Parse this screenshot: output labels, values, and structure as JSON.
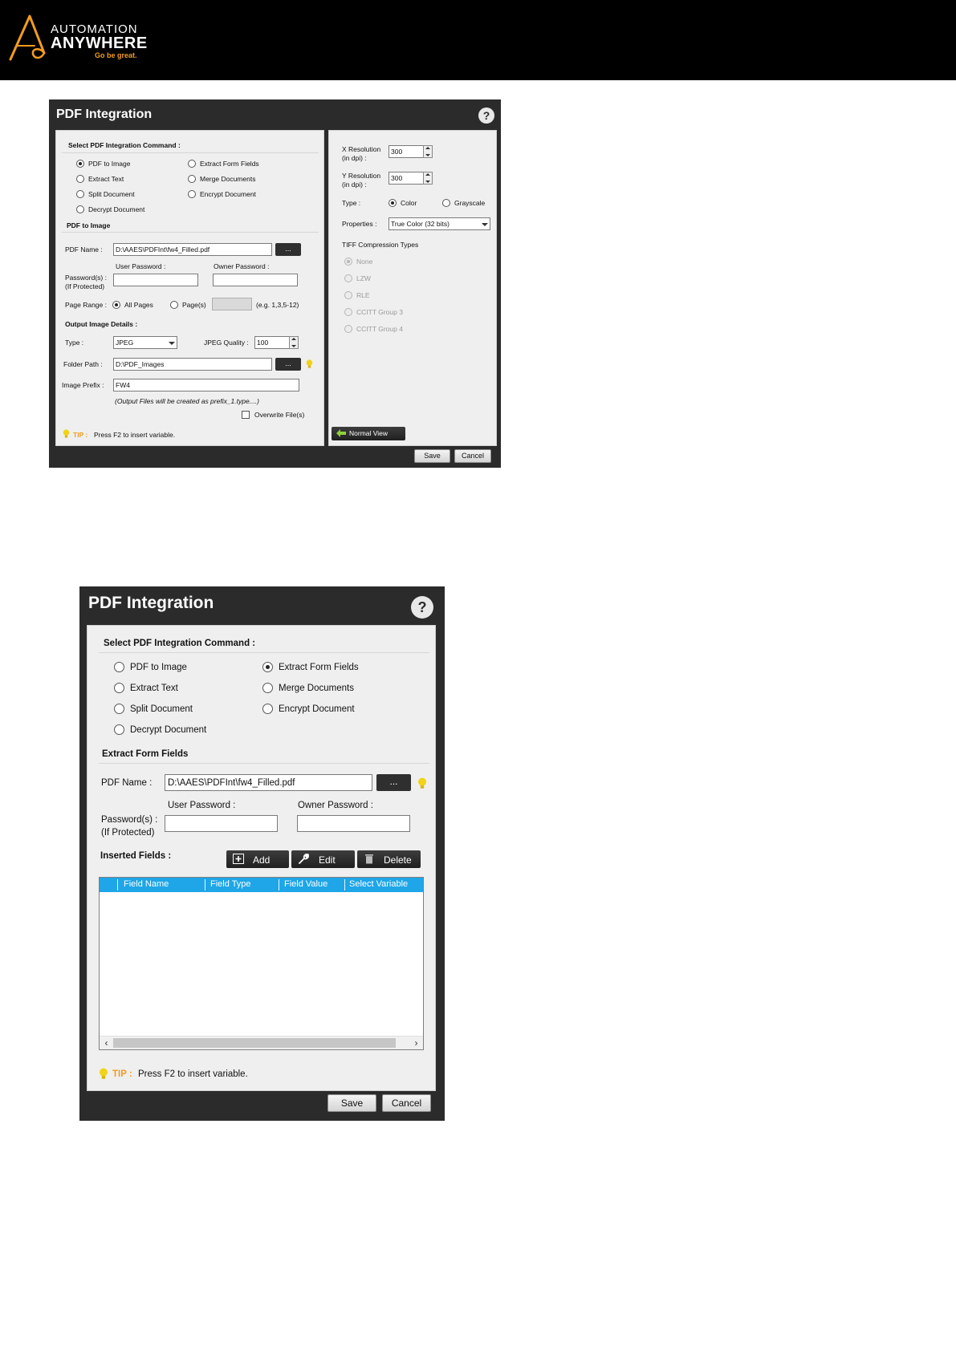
{
  "brand": {
    "line1": "AUTOMATION",
    "line2": "ANYWHERE",
    "tagline": "Go be great.",
    "accent_color": "#f39c1f"
  },
  "dialog1": {
    "title": "PDF Integration",
    "help": "?",
    "section_command": "Select PDF Integration Command :",
    "commands": [
      "PDF to Image",
      "Extract Text",
      "Split Document",
      "Decrypt Document",
      "Extract Form Fields",
      "Merge Documents",
      "Encrypt Document"
    ],
    "selected_command": "PDF to Image",
    "section_mode": "PDF to Image",
    "pdf_name_label": "PDF Name :",
    "pdf_name_value": "D:\\AAES\\PDFInt\\fw4_Filled.pdf",
    "browse_label": "...",
    "user_password_label": "User Password :",
    "owner_password_label": "Owner Password :",
    "passwords_label_1": "Password(s) :",
    "passwords_label_2": "(If Protected)",
    "page_range_label": "Page Range :",
    "all_pages_label": "All Pages",
    "pages_label": "Page(s)",
    "pages_hint": "(e.g. 1,3,5-12)",
    "output_section": "Output Image Details :",
    "type_label": "Type :",
    "type_value": "JPEG",
    "jpeg_quality_label": "JPEG Quality :",
    "jpeg_quality_value": "100",
    "folder_path_label": "Folder Path :",
    "folder_path_value": "D:\\PDF_Images",
    "image_prefix_label": "Image Prefix :",
    "image_prefix_value": "FW4",
    "output_hint": "(Output Files will be created as prefix_1.type....)",
    "overwrite_label": "Overwrite File(s)",
    "tip_label": "TIP :",
    "tip_text": "Press F2 to insert variable.",
    "x_res_label_1": "X Resolution",
    "x_res_label_2": "(in dpi) :",
    "x_res_value": "300",
    "y_res_label_1": "Y Resolution",
    "y_res_label_2": "(in dpi) :",
    "y_res_value": "300",
    "color_type_label": "Type :",
    "color_label": "Color",
    "grayscale_label": "Grayscale",
    "properties_label": "Properties :",
    "properties_value": "True Color (32 bits)",
    "tiff_label": "TIFF Compression Types",
    "tiff_options": [
      "None",
      "LZW",
      "RLE",
      "CCITT Group 3",
      "CCITT Group 4"
    ],
    "normal_view_label": "Normal View",
    "save_label": "Save",
    "cancel_label": "Cancel"
  },
  "dialog2": {
    "title": "PDF Integration",
    "help": "?",
    "section_command": "Select PDF Integration Command :",
    "commands": [
      "PDF to Image",
      "Extract Text",
      "Split Document",
      "Decrypt Document",
      "Extract Form Fields",
      "Merge Documents",
      "Encrypt Document"
    ],
    "selected_command": "Extract Form Fields",
    "section_mode": "Extract Form Fields",
    "pdf_name_label": "PDF Name :",
    "pdf_name_value": "D:\\AAES\\PDFInt\\fw4_Filled.pdf",
    "browse_label": "...",
    "user_password_label": "User Password :",
    "owner_password_label": "Owner Password :",
    "passwords_label_1": "Password(s) :",
    "passwords_label_2": "(If Protected)",
    "inserted_fields_label": "Inserted Fields :",
    "add_label": "Add",
    "edit_label": "Edit",
    "delete_label": "Delete",
    "columns": [
      "Field Name",
      "Field Type",
      "Field Value",
      "Select Variable"
    ],
    "tip_label": "TIP :",
    "tip_text": "Press F2 to insert variable.",
    "save_label": "Save",
    "cancel_label": "Cancel",
    "grid_header_color": "#1ea6e8"
  }
}
